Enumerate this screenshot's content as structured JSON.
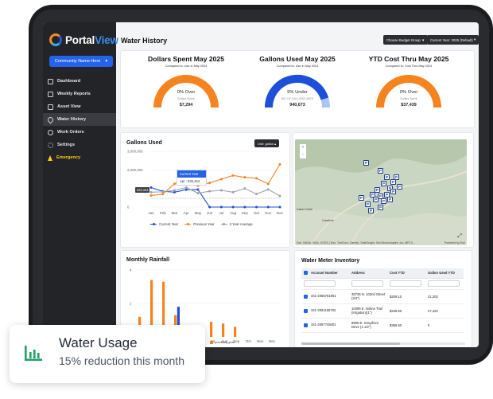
{
  "brand": {
    "name_a": "Portal",
    "name_b": "View"
  },
  "sidebar": {
    "community": "Community Name Here",
    "items": [
      {
        "label": "Dashboard",
        "icon": "home-icon"
      },
      {
        "label": "Weekly Reports",
        "icon": "report-icon"
      },
      {
        "label": "Asset View",
        "icon": "grid-icon"
      },
      {
        "label": "Water History",
        "icon": "droplet-icon",
        "active": true
      },
      {
        "label": "Work Orders",
        "icon": "clock-icon"
      },
      {
        "label": "Settings",
        "icon": "gear-icon"
      },
      {
        "label": "Emergency",
        "icon": "warning-icon"
      }
    ]
  },
  "header": {
    "title": "Water History",
    "budget_button": "Choose Budget Group",
    "year_button": "Current Year: 2025 (Default)"
  },
  "kpis": [
    {
      "title": "Dollars Spent May 2025",
      "subtitle": "Compared to: Use in May 2024",
      "main": "0% Over",
      "label": "Dollars Spent",
      "value": "$7,294",
      "fraction": 1.0,
      "color": "#f5841f"
    },
    {
      "title": "Gallons Used May 2025",
      "subtitle": "Compared to: Use in May 2024",
      "main": "9% Under",
      "label": "NO. OF GALLONS USED",
      "value": "940,673",
      "fraction": 0.91,
      "color": "#1e4fd8"
    },
    {
      "title": "YTD Cost Thru May 2025",
      "subtitle": "Compared to: Cost Thru May 2024",
      "main": "0% Over",
      "label": "Dollars Spent",
      "value": "$37,439",
      "fraction": 1.0,
      "color": "#f5841f"
    }
  ],
  "gallons_panel": {
    "title": "Gallons Used",
    "unit_button": "Unit: gallon",
    "tooltip_title": "Current Year",
    "tooltip_body": "Apr : 935,464",
    "y_flag": "955,464"
  },
  "rain_panel": {
    "title": "Monthly Rainfall",
    "legend_prev": "previous_year"
  },
  "map": {
    "attribution": "Esri, NASA, NGA, USGS | Esri, TomTom, Garmin, SafeGraph, GeoTechnologies, Inc, METI/...",
    "powered": "Powered by Esri",
    "labels": [
      "Cave Creek",
      "Carefree"
    ]
  },
  "inventory": {
    "title": "Water Meter Inventory",
    "columns": [
      "Account Number",
      "Address",
      "Cost YTD",
      "Gallon Used YTD"
    ],
    "rows": [
      {
        "account": "341-2066701901",
        "address": "38735 N. 102nd Street (3/4\")",
        "cost": "$209.10",
        "gallons": "21,202"
      },
      {
        "account": "341-2091165702",
        "address": "10396 E. Nolina Trail (Irrigation)(1\")",
        "cost": "$239.50",
        "gallons": "27,422"
      },
      {
        "account": "341-2087749401",
        "address": "9906 E. Graythorn Drive (1-1/2\")",
        "cost": "$365.50",
        "gallons": "0"
      }
    ]
  },
  "callout": {
    "title": "Water Usage",
    "subtitle": "15% reduction this month"
  },
  "chart_data": [
    {
      "type": "line",
      "title": "Gallons Used",
      "x": [
        "Jan",
        "Feb",
        "Mar",
        "Apr",
        "May",
        "Jun",
        "Jul",
        "Aug",
        "Sep",
        "Oct",
        "Nov",
        "Dec"
      ],
      "yticks": [
        "3,000,000",
        "2,000,000",
        "0"
      ],
      "ylim": [
        0,
        3000000
      ],
      "series": [
        {
          "name": "Current Year",
          "color": "#1e4fd8",
          "values": [
            1050000,
            850000,
            800000,
            935464,
            940673,
            0,
            0,
            0,
            0,
            0,
            0,
            0
          ]
        },
        {
          "name": "Previous Year",
          "color": "#f5841f",
          "values": [
            620000,
            700000,
            1250000,
            1600000,
            1150000,
            1300000,
            1500000,
            1700000,
            1600000,
            1550000,
            1250000,
            2300000
          ]
        },
        {
          "name": "3 Year Average",
          "color": "#9ca3af",
          "values": [
            800000,
            820000,
            900000,
            1050000,
            750000,
            850000,
            900000,
            800000,
            1000000,
            700000,
            950000,
            600000
          ]
        }
      ]
    },
    {
      "type": "bar",
      "title": "Monthly Rainfall",
      "categories": [
        "Jan",
        "Feb",
        "Mar",
        "Apr",
        "May",
        "Jun",
        "Jul",
        "Aug",
        "Sep",
        "Oct",
        "Nov",
        "Dec"
      ],
      "yticks": [
        "4",
        "2"
      ],
      "ylim": [
        0,
        4
      ],
      "x_visible_labels": [
        "Jul",
        "Aug",
        "Sep",
        "Oct",
        "Nov",
        "Dec"
      ],
      "series": [
        {
          "name": "current_year",
          "color": "#1e4fd8",
          "values": [
            0,
            0,
            0,
            1.8,
            0.25,
            0,
            0,
            0,
            0,
            0,
            0,
            0
          ]
        },
        {
          "name": "previous_year",
          "color": "#f5841f",
          "values": [
            1.2,
            3.4,
            3.3,
            1.3,
            0.3,
            0.15,
            0.9,
            0.8,
            0.6,
            0,
            0,
            0
          ]
        }
      ]
    }
  ],
  "colors": {
    "accent": "#2563eb",
    "orange": "#f5841f",
    "sidebar": "#232427",
    "callout_icon": "#22a06b"
  }
}
